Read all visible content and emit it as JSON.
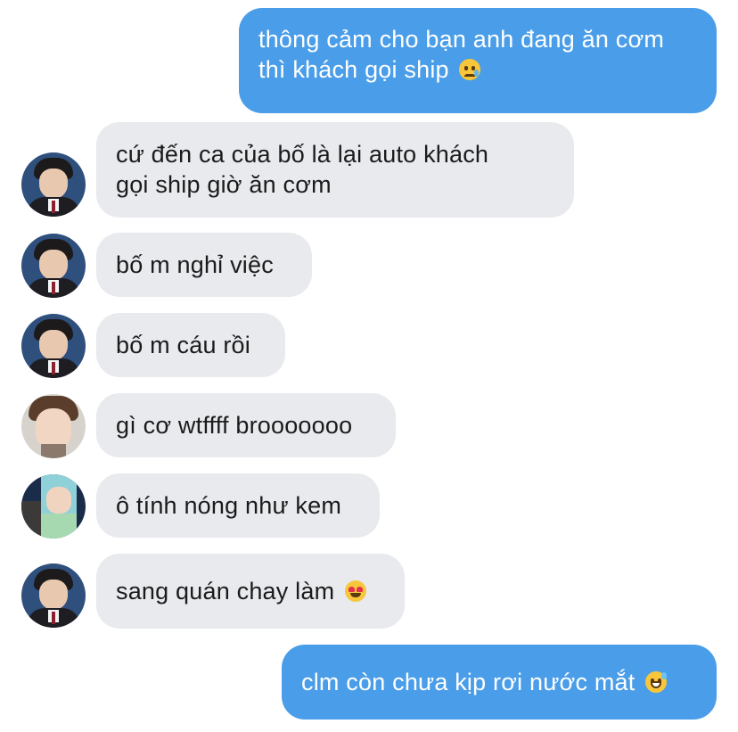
{
  "messages": [
    {
      "dir": "out",
      "lines": [
        "thông cảm cho bạn anh đang ăn cơm",
        "thì khách gọi ship"
      ],
      "emoji": "crying-face"
    },
    {
      "dir": "in",
      "avatar": "boy-school-uniform",
      "lines": [
        "cứ đến ca của bố là lại auto khách",
        "gọi ship giờ ăn cơm"
      ]
    },
    {
      "dir": "in",
      "avatar": "boy-school-uniform",
      "lines": [
        "bố m nghỉ việc"
      ]
    },
    {
      "dir": "in",
      "avatar": "boy-school-uniform",
      "lines": [
        "bố m cáu rồi"
      ]
    },
    {
      "dir": "in",
      "avatar": "boy-brown-hair",
      "lines": [
        "gì cơ wtffff brooooooo"
      ]
    },
    {
      "dir": "in",
      "avatar": "boy-poster",
      "lines": [
        "ô tính nóng như kem"
      ]
    },
    {
      "dir": "in",
      "avatar": "boy-school-uniform",
      "lines": [
        "sang quán chay làm"
      ],
      "emoji": "heart-eyes-face"
    },
    {
      "dir": "out",
      "lines": [
        "clm còn chưa kịp rơi nước mắt"
      ],
      "emoji": "grinning-sweat-face"
    }
  ],
  "colors": {
    "outgoing_bubble": "#4a9de8",
    "incoming_bubble": "#e8eaee",
    "incoming_text": "#1b1b1b",
    "outgoing_text": "#ffffff"
  }
}
